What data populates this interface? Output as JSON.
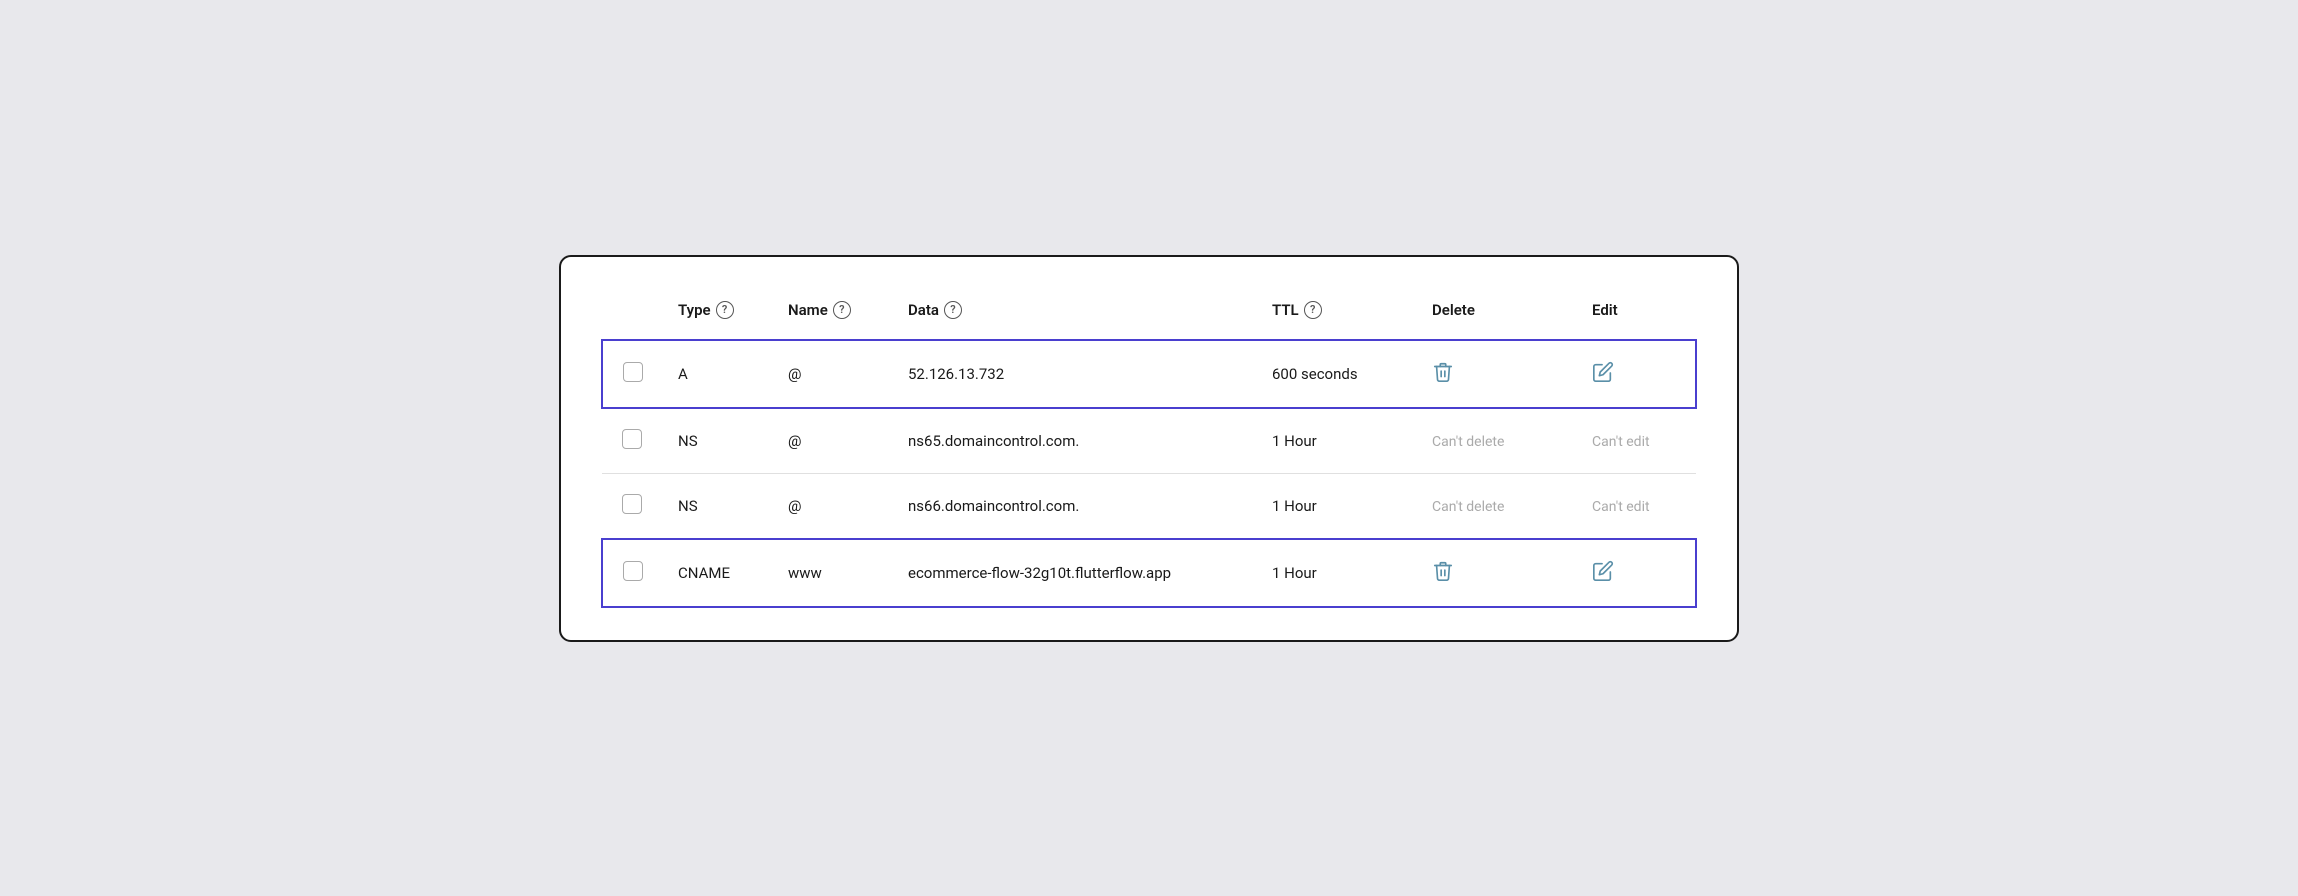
{
  "table": {
    "columns": {
      "checkbox": "",
      "type": "Type",
      "name": "Name",
      "data": "Data",
      "ttl": "TTL",
      "delete": "Delete",
      "edit": "Edit"
    },
    "help_icon": "?",
    "rows": [
      {
        "id": "row-1",
        "highlighted": true,
        "checkbox_checked": false,
        "type": "A",
        "name": "@",
        "data": "52.126.13.732",
        "ttl": "600 seconds",
        "delete_action": "trash",
        "edit_action": "edit"
      },
      {
        "id": "row-2",
        "highlighted": false,
        "checkbox_checked": false,
        "type": "NS",
        "name": "@",
        "data": "ns65.domaincontrol.com.",
        "ttl": "1 Hour",
        "delete_action": "cant_delete",
        "edit_action": "cant_edit",
        "cant_delete_label": "Can't delete",
        "cant_edit_label": "Can't edit"
      },
      {
        "id": "row-3",
        "highlighted": false,
        "checkbox_checked": false,
        "type": "NS",
        "name": "@",
        "data": "ns66.domaincontrol.com.",
        "ttl": "1 Hour",
        "delete_action": "cant_delete",
        "edit_action": "cant_edit",
        "cant_delete_label": "Can't delete",
        "cant_edit_label": "Can't edit"
      },
      {
        "id": "row-4",
        "highlighted": true,
        "checkbox_checked": false,
        "type": "CNAME",
        "name": "www",
        "data": "ecommerce-flow-32g10t.flutterflow.app",
        "ttl": "1 Hour",
        "delete_action": "trash",
        "edit_action": "edit"
      }
    ]
  }
}
